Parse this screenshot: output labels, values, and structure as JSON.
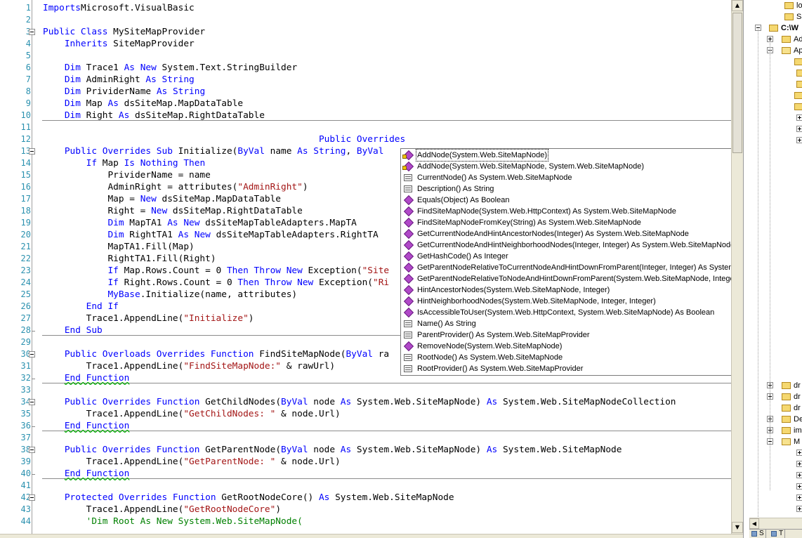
{
  "editor": {
    "lines": [
      {
        "n": "1",
        "t": [
          [
            "k",
            "Imports"
          ],
          [
            "",
            "Microsoft.VisualBasic"
          ]
        ]
      },
      {
        "n": "2",
        "t": []
      },
      {
        "n": "3",
        "t": [
          [
            "k",
            "Public Class"
          ],
          [
            "",
            " MySiteMapProvider"
          ]
        ]
      },
      {
        "n": "4",
        "t": [
          [
            "",
            "    "
          ],
          [
            "k",
            "Inherits"
          ],
          [
            "",
            " SiteMapProvider"
          ]
        ]
      },
      {
        "n": "5",
        "t": []
      },
      {
        "n": "6",
        "t": [
          [
            "",
            "    "
          ],
          [
            "k",
            "Dim"
          ],
          [
            "",
            " Trace1 "
          ],
          [
            "k",
            "As New"
          ],
          [
            "",
            " System.Text.StringBuilder"
          ]
        ]
      },
      {
        "n": "7",
        "t": [
          [
            "",
            "    "
          ],
          [
            "k",
            "Dim"
          ],
          [
            "",
            " AdminRight "
          ],
          [
            "k",
            "As String"
          ]
        ]
      },
      {
        "n": "8",
        "t": [
          [
            "",
            "    "
          ],
          [
            "k",
            "Dim"
          ],
          [
            "",
            " PrividerName "
          ],
          [
            "k",
            "As String"
          ]
        ]
      },
      {
        "n": "9",
        "t": [
          [
            "",
            "    "
          ],
          [
            "k",
            "Dim"
          ],
          [
            "",
            " Map "
          ],
          [
            "k",
            "As"
          ],
          [
            "",
            " dsSiteMap.MapDataTable"
          ]
        ]
      },
      {
        "n": "10",
        "t": [
          [
            "",
            "    "
          ],
          [
            "k",
            "Dim"
          ],
          [
            "",
            " Right "
          ],
          [
            "k",
            "As"
          ],
          [
            "",
            " dsSiteMap.RightDataTable"
          ]
        ]
      },
      {
        "n": "11",
        "t": []
      },
      {
        "n": "12",
        "t": [
          [
            "",
            "                                                   "
          ],
          [
            "k",
            "Public Overrides"
          ]
        ]
      },
      {
        "n": "13",
        "t": [
          [
            "",
            "    "
          ],
          [
            "k",
            "Public Overrides Sub"
          ],
          [
            "",
            " Initialize("
          ],
          [
            "k",
            "ByVal"
          ],
          [
            "",
            " name "
          ],
          [
            "k",
            "As String"
          ],
          [
            "",
            ", "
          ],
          [
            "k",
            "ByVal"
          ]
        ]
      },
      {
        "n": "14",
        "t": [
          [
            "",
            "        "
          ],
          [
            "k",
            "If"
          ],
          [
            "",
            " Map "
          ],
          [
            "k",
            "Is Nothing Then"
          ]
        ]
      },
      {
        "n": "15",
        "t": [
          [
            "",
            "            PrividerName = name"
          ]
        ]
      },
      {
        "n": "16",
        "t": [
          [
            "",
            "            AdminRight = attributes("
          ],
          [
            "s",
            "\"AdminRight\""
          ],
          [
            "",
            ")"
          ]
        ]
      },
      {
        "n": "17",
        "t": [
          [
            "",
            "            Map = "
          ],
          [
            "k",
            "New"
          ],
          [
            "",
            " dsSiteMap.MapDataTable"
          ]
        ]
      },
      {
        "n": "18",
        "t": [
          [
            "",
            "            Right = "
          ],
          [
            "k",
            "New"
          ],
          [
            "",
            " dsSiteMap.RightDataTable"
          ]
        ]
      },
      {
        "n": "19",
        "t": [
          [
            "",
            "            "
          ],
          [
            "k",
            "Dim"
          ],
          [
            "",
            " MapTA1 "
          ],
          [
            "k",
            "As New"
          ],
          [
            "",
            " dsSiteMapTableAdapters.MapTA"
          ]
        ]
      },
      {
        "n": "20",
        "t": [
          [
            "",
            "            "
          ],
          [
            "k",
            "Dim"
          ],
          [
            "",
            " RightTA1 "
          ],
          [
            "k",
            "As New"
          ],
          [
            "",
            " dsSiteMapTableAdapters.RightTA"
          ]
        ]
      },
      {
        "n": "21",
        "t": [
          [
            "",
            "            MapTA1.Fill(Map)"
          ]
        ]
      },
      {
        "n": "22",
        "t": [
          [
            "",
            "            RightTA1.Fill(Right)"
          ]
        ]
      },
      {
        "n": "23",
        "t": [
          [
            "",
            "            "
          ],
          [
            "k",
            "If"
          ],
          [
            "",
            " Map.Rows.Count = 0 "
          ],
          [
            "k",
            "Then Throw New"
          ],
          [
            "",
            " Exception("
          ],
          [
            "s",
            "\"Site"
          ]
        ]
      },
      {
        "n": "24",
        "t": [
          [
            "",
            "            "
          ],
          [
            "k",
            "If"
          ],
          [
            "",
            " Right.Rows.Count = 0 "
          ],
          [
            "k",
            "Then Throw New"
          ],
          [
            "",
            " Exception("
          ],
          [
            "s",
            "\"Ri"
          ]
        ]
      },
      {
        "n": "25",
        "t": [
          [
            "",
            "            "
          ],
          [
            "k",
            "MyBase"
          ],
          [
            "",
            ".Initialize(name, attributes)"
          ]
        ]
      },
      {
        "n": "26",
        "t": [
          [
            "",
            "        "
          ],
          [
            "k",
            "End If"
          ]
        ]
      },
      {
        "n": "27",
        "t": [
          [
            "",
            "        Trace1.AppendLine("
          ],
          [
            "s",
            "\"Initialize\""
          ],
          [
            "",
            ")"
          ]
        ]
      },
      {
        "n": "28",
        "t": [
          [
            "",
            "    "
          ],
          [
            "k",
            "End Sub"
          ]
        ]
      },
      {
        "n": "29",
        "t": []
      },
      {
        "n": "30",
        "t": [
          [
            "",
            "    "
          ],
          [
            "k",
            "Public Overloads Overrides Function"
          ],
          [
            "",
            " FindSiteMapNode("
          ],
          [
            "k",
            "ByVal"
          ],
          [
            "",
            " ra"
          ]
        ]
      },
      {
        "n": "31",
        "t": [
          [
            "",
            "        Trace1.AppendLine("
          ],
          [
            "s",
            "\"FindSiteMapNode:\""
          ],
          [
            "",
            " & rawUrl)"
          ]
        ]
      },
      {
        "n": "32",
        "t": [
          [
            "",
            "    "
          ],
          [
            "kq",
            "End Function"
          ]
        ]
      },
      {
        "n": "33",
        "t": []
      },
      {
        "n": "34",
        "t": [
          [
            "",
            "    "
          ],
          [
            "k",
            "Public Overrides Function"
          ],
          [
            "",
            " GetChildNodes("
          ],
          [
            "k",
            "ByVal"
          ],
          [
            "",
            " node "
          ],
          [
            "k",
            "As"
          ],
          [
            "",
            " System.Web.SiteMapNode) "
          ],
          [
            "k",
            "As"
          ],
          [
            "",
            " System.Web.SiteMapNodeCollection"
          ]
        ]
      },
      {
        "n": "35",
        "t": [
          [
            "",
            "        Trace1.AppendLine("
          ],
          [
            "s",
            "\"GetChildNodes: \""
          ],
          [
            "",
            " & node.Url)"
          ]
        ]
      },
      {
        "n": "36",
        "t": [
          [
            "",
            "    "
          ],
          [
            "kq",
            "End Function"
          ]
        ]
      },
      {
        "n": "37",
        "t": []
      },
      {
        "n": "38",
        "t": [
          [
            "",
            "    "
          ],
          [
            "k",
            "Public Overrides Function"
          ],
          [
            "",
            " GetParentNode("
          ],
          [
            "k",
            "ByVal"
          ],
          [
            "",
            " node "
          ],
          [
            "k",
            "As"
          ],
          [
            "",
            " System.Web.SiteMapNode) "
          ],
          [
            "k",
            "As"
          ],
          [
            "",
            " System.Web.SiteMapNode"
          ]
        ]
      },
      {
        "n": "39",
        "t": [
          [
            "",
            "        Trace1.AppendLine("
          ],
          [
            "s",
            "\"GetParentNode: \""
          ],
          [
            "",
            " & node.Url)"
          ]
        ]
      },
      {
        "n": "40",
        "t": [
          [
            "",
            "    "
          ],
          [
            "kq",
            "End Function"
          ]
        ]
      },
      {
        "n": "41",
        "t": []
      },
      {
        "n": "42",
        "t": [
          [
            "",
            "    "
          ],
          [
            "k",
            "Protected Overrides Function"
          ],
          [
            "",
            " GetRootNodeCore() "
          ],
          [
            "k",
            "As"
          ],
          [
            "",
            " System.Web.SiteMapNode"
          ]
        ]
      },
      {
        "n": "43",
        "t": [
          [
            "",
            "        Trace1.AppendLine("
          ],
          [
            "s",
            "\"GetRootNodeCore\""
          ],
          [
            "",
            ")"
          ]
        ]
      },
      {
        "n": "44",
        "t": [
          [
            "",
            "        "
          ],
          [
            "c",
            "'Dim Root As New System.Web.SiteMapNode("
          ]
        ]
      }
    ]
  },
  "intellisense": {
    "selected_index": 0,
    "items": [
      {
        "icon": "method-icon",
        "shield": true,
        "label": "AddNode(System.Web.SiteMapNode)"
      },
      {
        "icon": "method-icon",
        "shield": true,
        "label": "AddNode(System.Web.SiteMapNode, System.Web.SiteMapNode)"
      },
      {
        "icon": "property-icon",
        "shield": false,
        "label": "CurrentNode() As System.Web.SiteMapNode"
      },
      {
        "icon": "property-icon",
        "shield": false,
        "label": "Description() As String"
      },
      {
        "icon": "method-icon",
        "shield": false,
        "label": "Equals(Object) As Boolean"
      },
      {
        "icon": "method-icon",
        "shield": false,
        "label": "FindSiteMapNode(System.Web.HttpContext) As System.Web.SiteMapNode"
      },
      {
        "icon": "method-icon",
        "shield": false,
        "label": "FindSiteMapNodeFromKey(String) As System.Web.SiteMapNode"
      },
      {
        "icon": "method-icon",
        "shield": false,
        "label": "GetCurrentNodeAndHintAncestorNodes(Integer) As System.Web.SiteMapNode"
      },
      {
        "icon": "method-icon",
        "shield": false,
        "label": "GetCurrentNodeAndHintNeighborhoodNodes(Integer, Integer) As System.Web.SiteMapNode"
      },
      {
        "icon": "method-icon",
        "shield": false,
        "label": "GetHashCode() As Integer"
      },
      {
        "icon": "method-icon",
        "shield": false,
        "label": "GetParentNodeRelativeToCurrentNodeAndHintDownFromParent(Integer, Integer) As System.Web.SiteMapNode"
      },
      {
        "icon": "method-icon",
        "shield": false,
        "label": "GetParentNodeRelativeToNodeAndHintDownFromParent(System.Web.SiteMapNode, Integer, Integer) As System"
      },
      {
        "icon": "method-icon",
        "shield": false,
        "label": "HintAncestorNodes(System.Web.SiteMapNode, Integer)"
      },
      {
        "icon": "method-icon",
        "shield": false,
        "label": "HintNeighborhoodNodes(System.Web.SiteMapNode, Integer, Integer)"
      },
      {
        "icon": "method-icon",
        "shield": false,
        "label": "IsAccessibleToUser(System.Web.HttpContext, System.Web.SiteMapNode) As Boolean"
      },
      {
        "icon": "property-icon",
        "shield": false,
        "label": "Name() As String"
      },
      {
        "icon": "property-icon",
        "shield": false,
        "label": "ParentProvider() As System.Web.SiteMapProvider"
      },
      {
        "icon": "method-icon",
        "shield": false,
        "label": "RemoveNode(System.Web.SiteMapNode)"
      },
      {
        "icon": "property-icon",
        "shield": false,
        "label": "RootNode() As System.Web.SiteMapNode"
      },
      {
        "icon": "property-icon",
        "shield": false,
        "label": "RootProvider() As System.Web.SiteMapProvider"
      }
    ]
  },
  "explorer": {
    "nodes": [
      {
        "label": "lo"
      },
      {
        "label": "Sa"
      },
      {
        "label": "C:\\W"
      },
      {
        "label": "Ad"
      },
      {
        "label": "Ap"
      },
      {
        "label": "dr"
      },
      {
        "label": "dr"
      },
      {
        "label": "dr"
      },
      {
        "label": "De"
      },
      {
        "label": "im"
      },
      {
        "label": "M"
      }
    ],
    "tabs": [
      {
        "label": "S"
      },
      {
        "label": "T"
      }
    ]
  },
  "colors": {
    "keyword": "#0000ff",
    "string": "#a31515",
    "comment": "#008000",
    "line_number": "#2b91af",
    "method_icon": "#b048c8"
  }
}
